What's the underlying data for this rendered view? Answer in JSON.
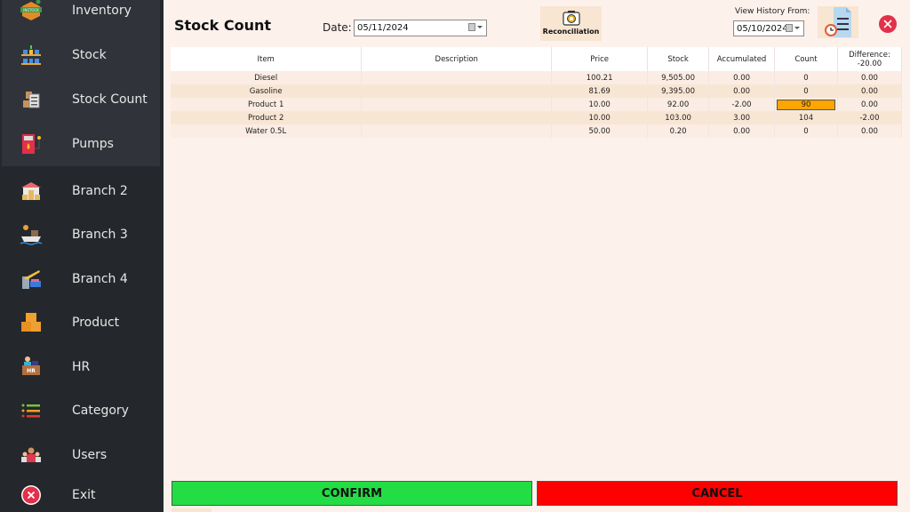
{
  "sidebar": {
    "items": [
      {
        "label": "Inventory",
        "icon": "inventory-box-icon"
      },
      {
        "label": "Stock",
        "icon": "stock-shelf-icon"
      },
      {
        "label": "Stock Count",
        "icon": "stock-count-icon"
      },
      {
        "label": "Pumps",
        "icon": "fuel-pump-icon"
      },
      {
        "label": "Branch 2",
        "icon": "warehouse-icon"
      },
      {
        "label": "Branch 3",
        "icon": "ship-icon"
      },
      {
        "label": "Branch 4",
        "icon": "crane-icon"
      },
      {
        "label": "Product",
        "icon": "boxes-icon"
      },
      {
        "label": "HR",
        "icon": "hr-desk-icon"
      },
      {
        "label": "Category",
        "icon": "list-icon"
      },
      {
        "label": "Users",
        "icon": "users-icon"
      },
      {
        "label": "Exit",
        "icon": "exit-icon"
      }
    ]
  },
  "header": {
    "title": "Stock Count",
    "date_label": "Date:",
    "date_value": "05/11/2024",
    "reconciliation_label": "Reconciliation",
    "history_label": "View History From:",
    "history_date": "05/10/2024"
  },
  "table": {
    "columns": [
      "Item",
      "Description",
      "Price",
      "Stock",
      "Accumulated",
      "Count",
      "Difference:"
    ],
    "difference_total": "-20.00",
    "rows": [
      {
        "item": "Diesel",
        "description": "",
        "price": "100.21",
        "stock": "9,505.00",
        "accumulated": "0.00",
        "count": "0",
        "difference": "0.00"
      },
      {
        "item": "Gasoline",
        "description": "",
        "price": "81.69",
        "stock": "9,395.00",
        "accumulated": "0.00",
        "count": "0",
        "difference": "0.00"
      },
      {
        "item": "Product 1",
        "description": "",
        "price": "10.00",
        "stock": "92.00",
        "accumulated": "-2.00",
        "count": "90",
        "difference": "0.00"
      },
      {
        "item": "Product 2",
        "description": "",
        "price": "10.00",
        "stock": "103.00",
        "accumulated": "3.00",
        "count": "104",
        "difference": "-2.00"
      },
      {
        "item": "Water 0.5L",
        "description": "",
        "price": "50.00",
        "stock": "0.20",
        "accumulated": "0.00",
        "count": "0",
        "difference": "0.00"
      }
    ]
  },
  "actions": {
    "confirm_label": "CONFIRM",
    "cancel_label": "CANCEL"
  },
  "colors": {
    "confirm": "#22dd44",
    "cancel": "#ff0000",
    "editing_cell": "#ffa500",
    "sidebar": "#24282c"
  }
}
